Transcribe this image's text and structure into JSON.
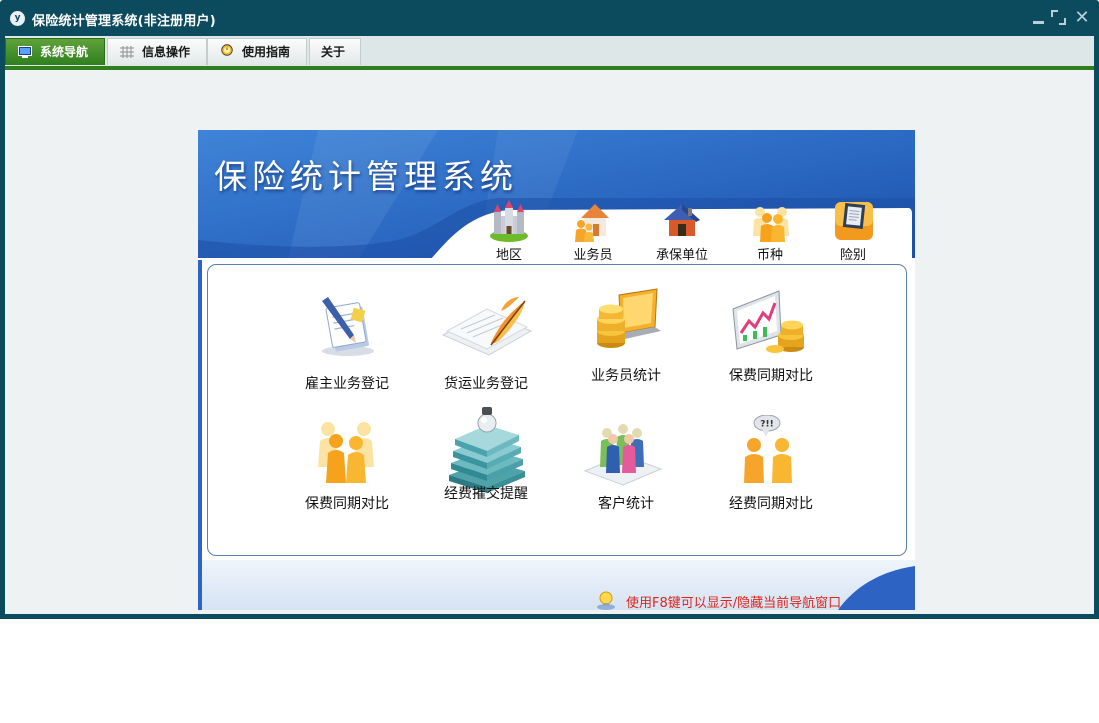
{
  "window": {
    "logo_text": "y",
    "title": "保险统计管理系统(非注册用户)"
  },
  "tabs": [
    {
      "label": "系统导航",
      "icon": "monitor-icon",
      "active": true
    },
    {
      "label": "信息操作",
      "icon": "grid-icon",
      "active": false
    },
    {
      "label": "使用指南",
      "icon": "clock-icon",
      "active": false
    },
    {
      "label": "关于",
      "icon": "",
      "active": false
    }
  ],
  "panel": {
    "banner_title": "保险统计管理系统",
    "categories": [
      {
        "label": "地区",
        "icon": "castle-icon"
      },
      {
        "label": "业务员",
        "icon": "house-people-icon"
      },
      {
        "label": "承保单位",
        "icon": "house-icon"
      },
      {
        "label": "币种",
        "icon": "people-group-icon"
      },
      {
        "label": "险别",
        "icon": "notebook-icon"
      }
    ],
    "items": [
      {
        "label": "雇主业务登记",
        "icon": "pen-document-icon"
      },
      {
        "label": "货运业务登记",
        "icon": "feather-paper-icon"
      },
      {
        "label": "业务员统计",
        "icon": "coins-laptop-icon"
      },
      {
        "label": "保费同期对比",
        "icon": "chart-coins-icon"
      },
      {
        "label": "保费同期对比",
        "icon": "people-group-icon"
      },
      {
        "label": "经费摧交提醒",
        "icon": "books-bulb-icon"
      },
      {
        "label": "客户统计",
        "icon": "people-figures-icon"
      },
      {
        "label": "经费同期对比",
        "icon": "talking-people-icon"
      }
    ],
    "hint": "使用F8键可以显示/隐藏当前导航窗口"
  },
  "colors": {
    "titlebar": "#0c4a5e",
    "tab_active": "#2f7f1e",
    "banner_blue": "#2d6cc4",
    "hint_red": "#e0241b"
  }
}
